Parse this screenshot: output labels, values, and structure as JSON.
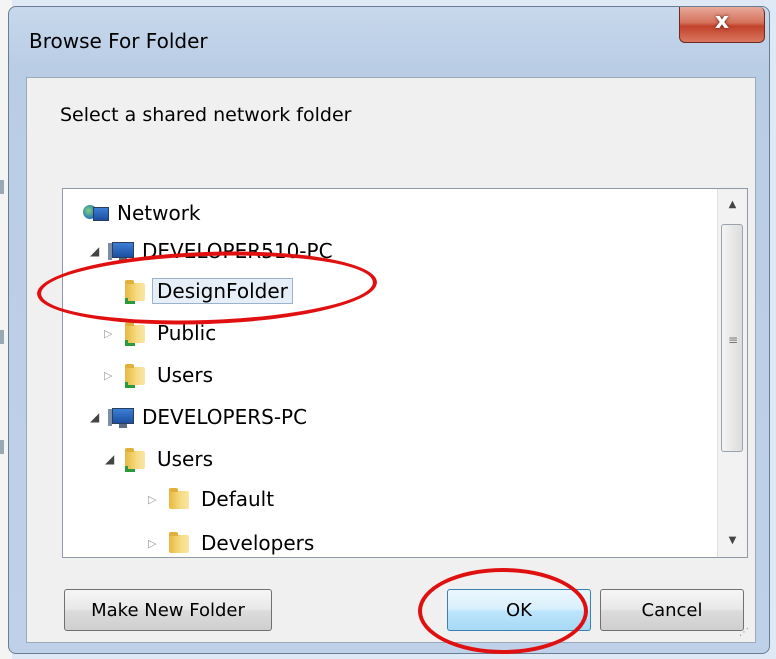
{
  "window": {
    "title": "Browse For Folder",
    "close_glyph": "x"
  },
  "prompt": "Select a shared network folder",
  "tree": [
    {
      "label": "Network",
      "icon": "network-icon",
      "expander": "none",
      "selected": false
    },
    {
      "label": "DEVELOPER510-PC",
      "icon": "computer-icon",
      "expander": "expanded",
      "selected": false
    },
    {
      "label": "DesignFolder",
      "icon": "shared-folder-icon",
      "expander": "none",
      "selected": true
    },
    {
      "label": "Public",
      "icon": "shared-folder-icon",
      "expander": "collapsed",
      "selected": false
    },
    {
      "label": "Users",
      "icon": "shared-folder-icon",
      "expander": "collapsed",
      "selected": false
    },
    {
      "label": "DEVELOPERS-PC",
      "icon": "computer-icon",
      "expander": "expanded",
      "selected": false
    },
    {
      "label": "Users",
      "icon": "shared-folder-icon",
      "expander": "expanded",
      "selected": false
    },
    {
      "label": "Default",
      "icon": "folder-icon",
      "expander": "collapsed",
      "selected": false
    },
    {
      "label": "Developers",
      "icon": "folder-icon",
      "expander": "collapsed",
      "selected": false
    }
  ],
  "buttons": {
    "make_new_folder": "Make New Folder",
    "ok": "OK",
    "cancel": "Cancel"
  },
  "colors": {
    "annotation": "#e01010",
    "title_bar": "#bfd1e8",
    "close_button": "#c2412b"
  }
}
